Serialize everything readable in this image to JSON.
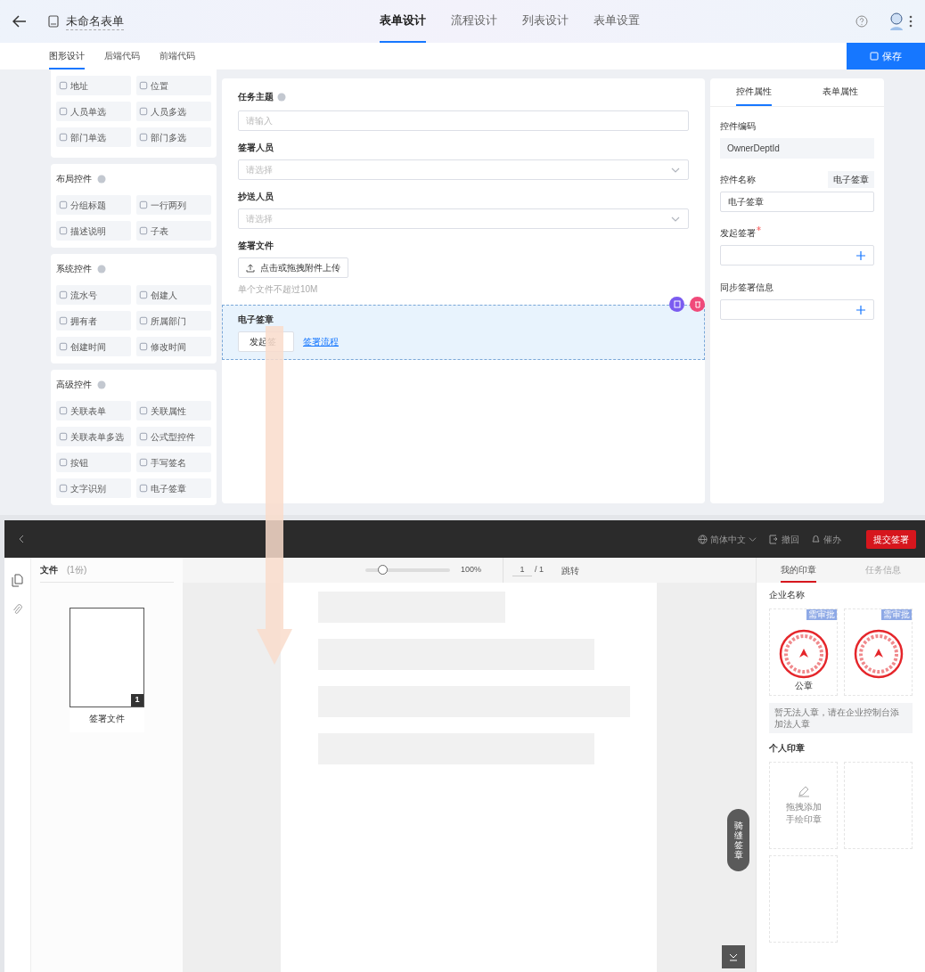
{
  "header": {
    "title": "未命名表单",
    "tabs": [
      {
        "label": "表单设计",
        "selected": true
      },
      {
        "label": "流程设计",
        "selected": false
      },
      {
        "label": "列表设计",
        "selected": false
      },
      {
        "label": "表单设置",
        "selected": false
      }
    ]
  },
  "subtabs": [
    {
      "label": "图形设计",
      "selected": true
    },
    {
      "label": "后端代码",
      "selected": false
    },
    {
      "label": "前端代码",
      "selected": false
    }
  ],
  "save_button": "保存",
  "palette": {
    "top_items": [
      "地址",
      "位置",
      "人员单选",
      "人员多选",
      "部门单选",
      "部门多选"
    ],
    "groups": [
      {
        "title": "布局控件",
        "items": [
          "分组标题",
          "一行两列",
          "描述说明",
          "子表"
        ]
      },
      {
        "title": "系统控件",
        "items": [
          "流水号",
          "创建人",
          "拥有者",
          "所属部门",
          "创建时间",
          "修改时间"
        ]
      },
      {
        "title": "高级控件",
        "items": [
          "关联表单",
          "关联属性",
          "关联表单多选",
          "公式型控件",
          "按钮",
          "手写签名",
          "文字识别",
          "电子签章"
        ]
      }
    ]
  },
  "form": {
    "fields": [
      {
        "kind": "input",
        "label": "任务主题",
        "placeholder": "请输入",
        "selected": false
      },
      {
        "kind": "select",
        "label": "签署人员",
        "placeholder": "请选择",
        "selected": false
      },
      {
        "kind": "select",
        "label": "抄送人员",
        "placeholder": "请选择",
        "selected": false
      },
      {
        "kind": "upload",
        "label": "签署文件",
        "button": "点击或拖拽附件上传",
        "hint": "单个文件不超过10M",
        "selected": false
      },
      {
        "kind": "signature",
        "label": "电子签章",
        "button": "发起签",
        "link": "签署流程",
        "selected": true
      }
    ]
  },
  "properties": {
    "tabs": [
      {
        "label": "控件属性",
        "selected": true
      },
      {
        "label": "表单属性",
        "selected": false
      }
    ],
    "fields": [
      {
        "kind": "readonly",
        "label": "控件编码",
        "value": "OwnerDeptId",
        "required": false
      },
      {
        "kind": "text",
        "label": "控件名称",
        "tag": "电子签章",
        "value": "电子签章",
        "required": false
      },
      {
        "kind": "add",
        "label": "发起签署",
        "required": true
      },
      {
        "kind": "add",
        "label": "同步签署信息",
        "required": false
      }
    ]
  },
  "viewer": {
    "language": "简体中文",
    "actions": [
      "撤回",
      "催办"
    ],
    "submit": "提交签署",
    "files": {
      "title": "文件",
      "count": "(1份)",
      "pages": [
        {
          "number": "1",
          "name": "签署文件"
        }
      ]
    },
    "toolbar": {
      "zoom_slider": {
        "level": 0.2
      },
      "zoom": "100%",
      "page": "1",
      "total": "/ 1",
      "jump": "跳转"
    },
    "side_tabs": [
      {
        "label": "我的印章",
        "selected": true
      },
      {
        "label": "任务信息",
        "selected": false
      }
    ],
    "company": {
      "title": "企业名称",
      "seals": [
        {
          "badge": "需审批",
          "caption": "公章"
        },
        {
          "badge": "需审批"
        }
      ],
      "notice": "暂无法人章，请在企业控制台添加法人章"
    },
    "personal": {
      "title": "个人印章",
      "add": [
        "拖拽添加",
        "手绘印章"
      ]
    },
    "paging_seal": "骑缝签章"
  }
}
